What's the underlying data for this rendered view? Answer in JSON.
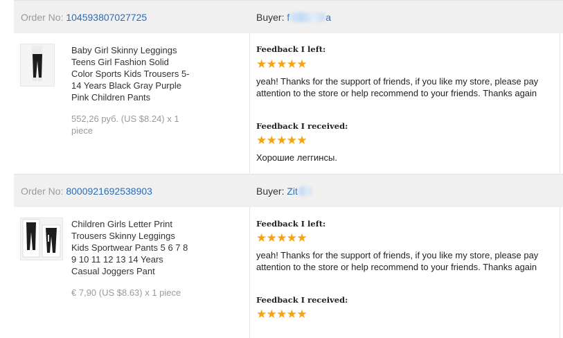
{
  "orders": [
    {
      "order_no_label": "Order No:",
      "order_no": "104593807027725",
      "buyer_label": "Buyer:",
      "buyer_name": "f",
      "buyer_name_tail": "a",
      "product_title": "Baby Girl Skinny Leggings Teens Girl Fashion Solid Color Sports Kids Trousers 5-14 Years Black Gray Purple Pink Children Pants",
      "price": "552,26 руб. (US $8.24) x 1 piece",
      "feedback_left_label": "Feedback I left:",
      "feedback_left_stars": 5,
      "feedback_left_text": "yeah! Thanks for the support of friends, if you like my store, please pay attention to the store or help recommend to your friends. Thanks again",
      "feedback_received_label": "Feedback I received:",
      "feedback_received_stars": 5,
      "feedback_received_text": "Хорошие леггинсы."
    },
    {
      "order_no_label": "Order No:",
      "order_no": "8000921692538903",
      "buyer_label": "Buyer:",
      "buyer_name": "Zit",
      "product_title": "Children Girls Letter Print Trousers Skinny Leggings Kids Sportwear Pants 5 6 7 8 9 10 11 12 13 14 Years Casual Joggers Pant",
      "price": "€ 7,90 (US $8.63) x 1 piece",
      "feedback_left_label": "Feedback I left:",
      "feedback_left_stars": 5,
      "feedback_left_text": "yeah! Thanks for the support of friends, if you like my store, please pay attention to the store or help recommend to your friends. Thanks again",
      "feedback_received_label": "Feedback I received:",
      "feedback_received_stars": 5
    }
  ],
  "colors": {
    "link": "#2a6cb6",
    "star": "#f5a30f",
    "header_bg": "#f0f0f0",
    "muted": "#9a9a9a"
  },
  "icons": {
    "star": "star-icon",
    "thumbnail": "product-thumbnail"
  }
}
